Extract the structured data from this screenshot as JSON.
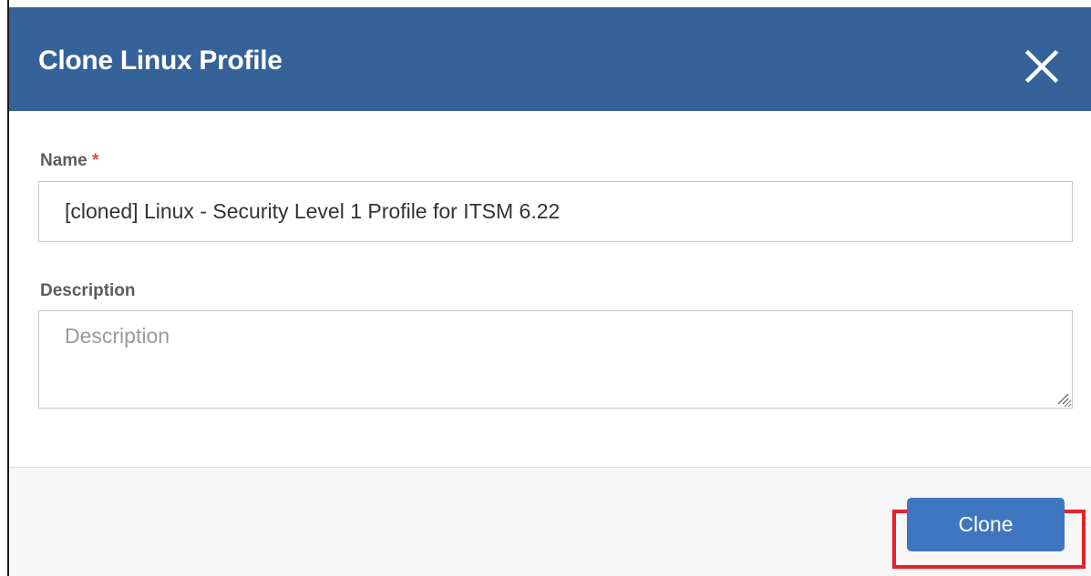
{
  "dialog": {
    "title": "Clone Linux Profile",
    "close_icon": "close-icon",
    "header_color": "#356299"
  },
  "form": {
    "name": {
      "label": "Name",
      "required_marker": "*",
      "value": "[cloned] Linux - Security Level 1 Profile for ITSM 6.22"
    },
    "description": {
      "label": "Description",
      "placeholder": "Description",
      "value": ""
    }
  },
  "footer": {
    "clone_label": "Clone",
    "button_color": "#3f76bf",
    "highlight_color": "#e8202a"
  }
}
